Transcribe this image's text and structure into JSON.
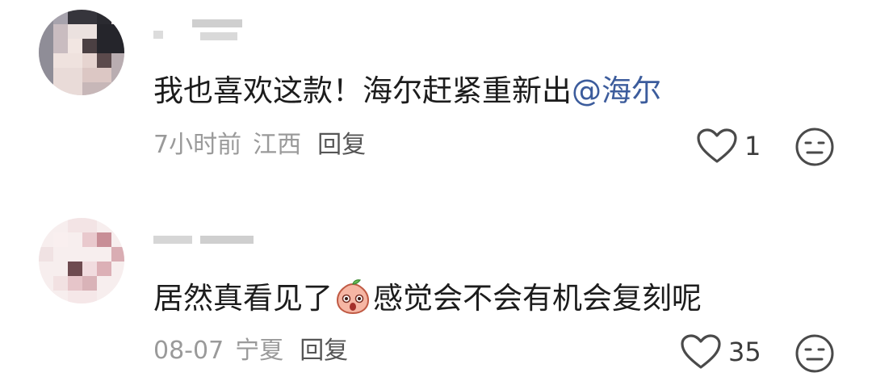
{
  "comments": [
    {
      "text": "我也喜欢这款！海尔赶紧重新出",
      "mention": "@海尔",
      "time": "7小时前",
      "location": "江西",
      "reply_label": "回复",
      "likes": "1"
    },
    {
      "text_before": "居然真看见了",
      "text_after": "感觉会不会有机会复刻呢",
      "time": "08-07",
      "location": "宁夏",
      "reply_label": "回复",
      "likes": "35"
    }
  ],
  "colors": {
    "mention": "#3c5c9c",
    "meta": "#9a9a9a",
    "text": "#1c1c1c"
  },
  "icons": [
    "avatar-pixelated",
    "heart-outline-icon",
    "neutral-face-icon",
    "peach-sticker-icon"
  ]
}
